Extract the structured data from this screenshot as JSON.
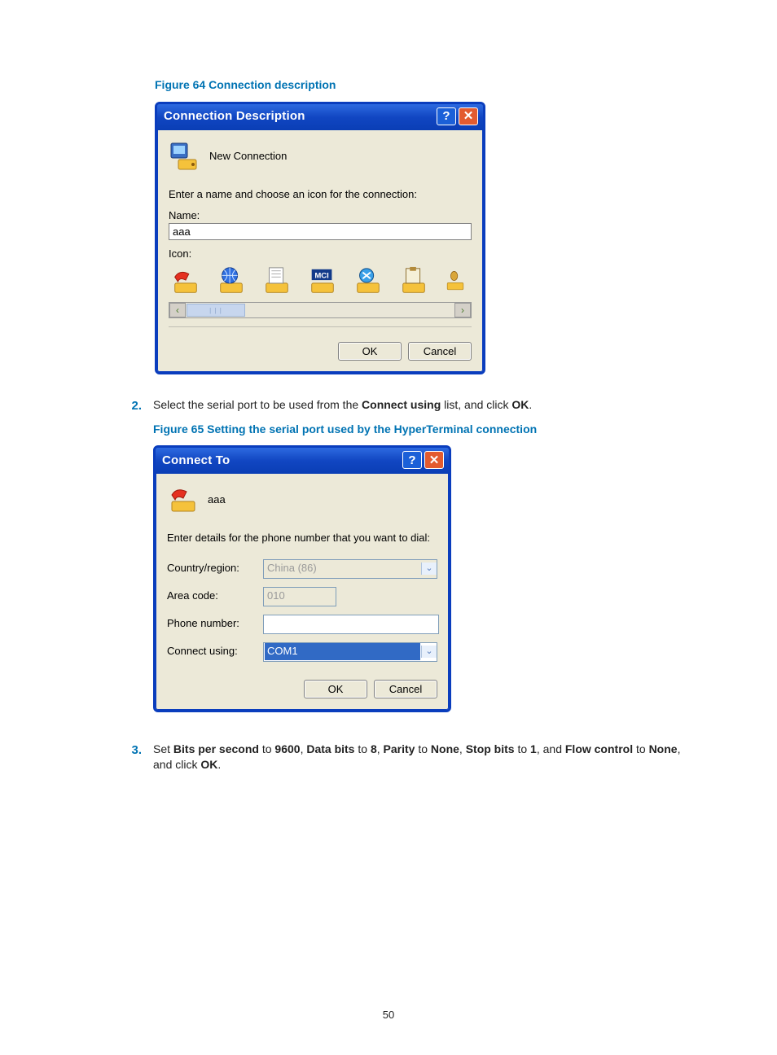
{
  "captions": {
    "fig64": "Figure 64 Connection description",
    "fig65": "Figure 65 Setting the serial port used by the HyperTerminal connection"
  },
  "dlg1": {
    "title": "Connection Description",
    "header_label": "New Connection",
    "instruction": "Enter a name and choose an icon for the connection:",
    "name_label": "Name:",
    "name_value": "aaa",
    "icon_label": "Icon:",
    "ok": "OK",
    "cancel": "Cancel"
  },
  "dlg2": {
    "title": "Connect To",
    "header_label": "aaa",
    "instruction": "Enter details for the phone number that you want to dial:",
    "country_label": "Country/region:",
    "country_value": "China (86)",
    "area_label": "Area code:",
    "area_value": "010",
    "phone_label": "Phone number:",
    "connect_label": "Connect using:",
    "connect_value": "COM1",
    "ok": "OK",
    "cancel": "Cancel"
  },
  "step2": {
    "num": "2.",
    "t1": "Select the serial port to be used from the ",
    "b1": "Connect using",
    "t2": " list, and click ",
    "b2": "OK",
    "t3": "."
  },
  "step3": {
    "num": "3.",
    "t1": "Set ",
    "b1": "Bits per second",
    "t2": " to ",
    "b2": "9600",
    "t3": ", ",
    "b3": "Data bits",
    "t4": " to ",
    "b4": "8",
    "t5": ", ",
    "b5": "Parity",
    "t6": " to ",
    "b6": "None",
    "t7": ", ",
    "b7": "Stop bits",
    "t8": " to ",
    "b8": "1",
    "t9": ", and ",
    "b9": "Flow control",
    "t10": " to ",
    "b10": "None",
    "t11": ", and click ",
    "b11": "OK",
    "t12": "."
  },
  "page_number": "50"
}
